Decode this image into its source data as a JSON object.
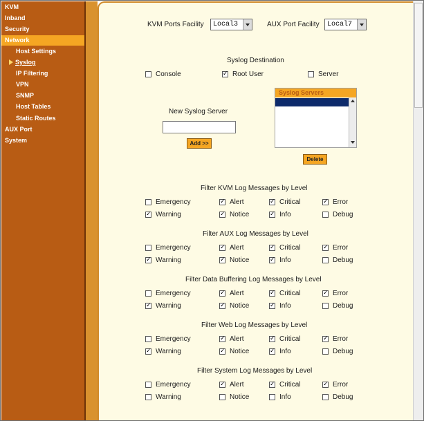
{
  "sidebar": {
    "items": [
      {
        "label": "KVM"
      },
      {
        "label": "Inband"
      },
      {
        "label": "Security"
      },
      {
        "label": "Network"
      },
      {
        "label": "Host Settings"
      },
      {
        "label": "Syslog"
      },
      {
        "label": "IP Filtering"
      },
      {
        "label": "VPN"
      },
      {
        "label": "SNMP"
      },
      {
        "label": "Host Tables"
      },
      {
        "label": "Static Routes"
      },
      {
        "label": "AUX Port"
      },
      {
        "label": "System"
      }
    ]
  },
  "facility": {
    "kvm_label": "KVM Ports Facility",
    "kvm_value": "Local3",
    "aux_label": "AUX Port Facility",
    "aux_value": "Local7"
  },
  "destination": {
    "title": "Syslog Destination",
    "options": [
      {
        "label": "Console",
        "checked": false
      },
      {
        "label": "Root User",
        "checked": true
      },
      {
        "label": "Server",
        "checked": false
      }
    ]
  },
  "new_server": {
    "label": "New Syslog Server",
    "value": "",
    "add_button": "Add >>"
  },
  "servers": {
    "title": "Syslog Servers",
    "delete_button": "Delete"
  },
  "filters": [
    {
      "title": "Filter KVM Log Messages by Level",
      "levels": [
        {
          "label": "Emergency",
          "checked": false
        },
        {
          "label": "Alert",
          "checked": true
        },
        {
          "label": "Critical",
          "checked": true
        },
        {
          "label": "Error",
          "checked": true
        },
        {
          "label": "Warning",
          "checked": true
        },
        {
          "label": "Notice",
          "checked": true
        },
        {
          "label": "Info",
          "checked": true
        },
        {
          "label": "Debug",
          "checked": false
        }
      ]
    },
    {
      "title": "Filter AUX Log Messages by Level",
      "levels": [
        {
          "label": "Emergency",
          "checked": false
        },
        {
          "label": "Alert",
          "checked": true
        },
        {
          "label": "Critical",
          "checked": true
        },
        {
          "label": "Error",
          "checked": true
        },
        {
          "label": "Warning",
          "checked": true
        },
        {
          "label": "Notice",
          "checked": true
        },
        {
          "label": "Info",
          "checked": true
        },
        {
          "label": "Debug",
          "checked": false
        }
      ]
    },
    {
      "title": "Filter Data Buffering Log Messages by Level",
      "levels": [
        {
          "label": "Emergency",
          "checked": false
        },
        {
          "label": "Alert",
          "checked": true
        },
        {
          "label": "Critical",
          "checked": true
        },
        {
          "label": "Error",
          "checked": true
        },
        {
          "label": "Warning",
          "checked": true
        },
        {
          "label": "Notice",
          "checked": true
        },
        {
          "label": "Info",
          "checked": true
        },
        {
          "label": "Debug",
          "checked": false
        }
      ]
    },
    {
      "title": "Filter Web Log Messages by Level",
      "levels": [
        {
          "label": "Emergency",
          "checked": false
        },
        {
          "label": "Alert",
          "checked": true
        },
        {
          "label": "Critical",
          "checked": true
        },
        {
          "label": "Error",
          "checked": true
        },
        {
          "label": "Warning",
          "checked": true
        },
        {
          "label": "Notice",
          "checked": true
        },
        {
          "label": "Info",
          "checked": true
        },
        {
          "label": "Debug",
          "checked": false
        }
      ]
    },
    {
      "title": "Filter System Log Messages by Level",
      "levels": [
        {
          "label": "Emergency",
          "checked": false
        },
        {
          "label": "Alert",
          "checked": true
        },
        {
          "label": "Critical",
          "checked": true
        },
        {
          "label": "Error",
          "checked": true
        },
        {
          "label": "Warning",
          "checked": false
        },
        {
          "label": "Notice",
          "checked": false
        },
        {
          "label": "Info",
          "checked": false
        },
        {
          "label": "Debug",
          "checked": false
        }
      ]
    }
  ],
  "colors": {
    "sidebar": "#b85c14",
    "accent": "#f5a623",
    "content_bg": "#fefbe4",
    "selected": "#0d2a6b"
  }
}
